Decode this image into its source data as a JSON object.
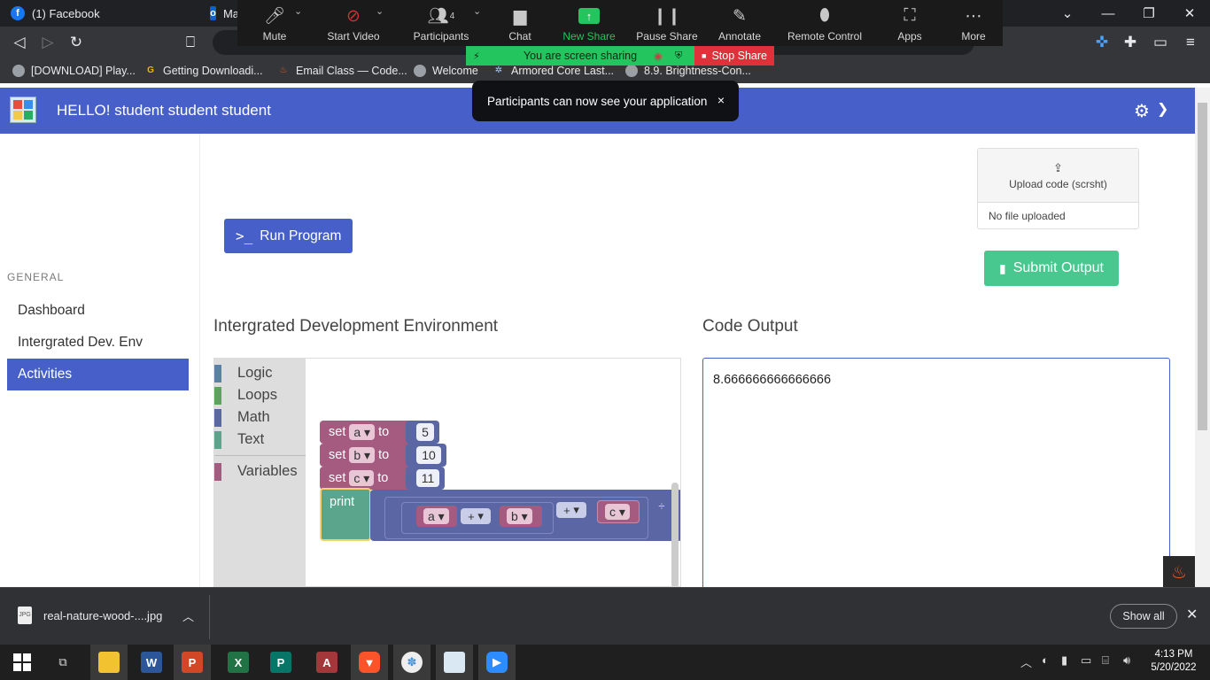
{
  "browser": {
    "tabs": [
      {
        "label": "(1) Facebook"
      },
      {
        "label": "Ma"
      }
    ],
    "window_controls": {
      "minimize": "—",
      "restore": "❐",
      "close": "✕",
      "tab_list": "⌄"
    },
    "bookmarks": [
      {
        "label": "[DOWNLOAD] Play..."
      },
      {
        "label": "Getting Downloadi..."
      },
      {
        "label": "Email Class — Code..."
      },
      {
        "label": "Welcome"
      },
      {
        "label": "Armored Core Last..."
      },
      {
        "label": "8.9. Brightness-Con..."
      }
    ]
  },
  "zoom": {
    "buttons": [
      {
        "label": "Mute"
      },
      {
        "label": "Start Video"
      },
      {
        "label": "Participants",
        "count": "4"
      },
      {
        "label": "Chat"
      },
      {
        "label": "New Share"
      },
      {
        "label": "Pause Share"
      },
      {
        "label": "Annotate"
      },
      {
        "label": "Remote Control"
      },
      {
        "label": "Apps"
      },
      {
        "label": "More"
      }
    ],
    "sharing_status": "You are screen sharing",
    "stop_share": "Stop Share",
    "toast": "Participants can now see your application",
    "toast_close": "×"
  },
  "app": {
    "title": "HELLO! student student student",
    "sidebar": {
      "section_label": "GENERAL",
      "items": [
        {
          "label": "Dashboard"
        },
        {
          "label": "Intergrated Dev. Env"
        },
        {
          "label": "Activities",
          "active": true
        }
      ]
    },
    "run_button": "Run Program",
    "upload": {
      "label": "Upload code (scrsht)",
      "status": "No file uploaded"
    },
    "submit_button": "Submit Output",
    "ide_title": "Intergrated Development Environment",
    "output_title": "Code Output",
    "output_text": "8.666666666666666",
    "blockly": {
      "categories": [
        {
          "label": "Logic",
          "color": "#5b80a5"
        },
        {
          "label": "Loops",
          "color": "#5ba55b"
        },
        {
          "label": "Math",
          "color": "#5b67a5"
        },
        {
          "label": "Text",
          "color": "#5ba58c"
        },
        {
          "label": "Variables",
          "color": "#a55b80"
        }
      ],
      "kw_set": "set",
      "kw_to": "to",
      "kw_print": "print",
      "assignments": [
        {
          "var": "a",
          "value": "5"
        },
        {
          "var": "b",
          "value": "10"
        },
        {
          "var": "c",
          "value": "11"
        }
      ],
      "expr": {
        "left": "a",
        "op1": "+",
        "right": "b",
        "op2": "+",
        "third": "c",
        "op3": "÷"
      }
    }
  },
  "downloads": {
    "file": "real-nature-wood-....jpg",
    "show_all": "Show all"
  },
  "taskbar": {
    "time": "4:13 PM",
    "date": "5/20/2022"
  },
  "colors": {
    "header": "#4760c9",
    "submit": "#48c78e",
    "variable_block": "#a55b80",
    "math_block": "#5b67a5",
    "text_block": "#5ba58c"
  }
}
